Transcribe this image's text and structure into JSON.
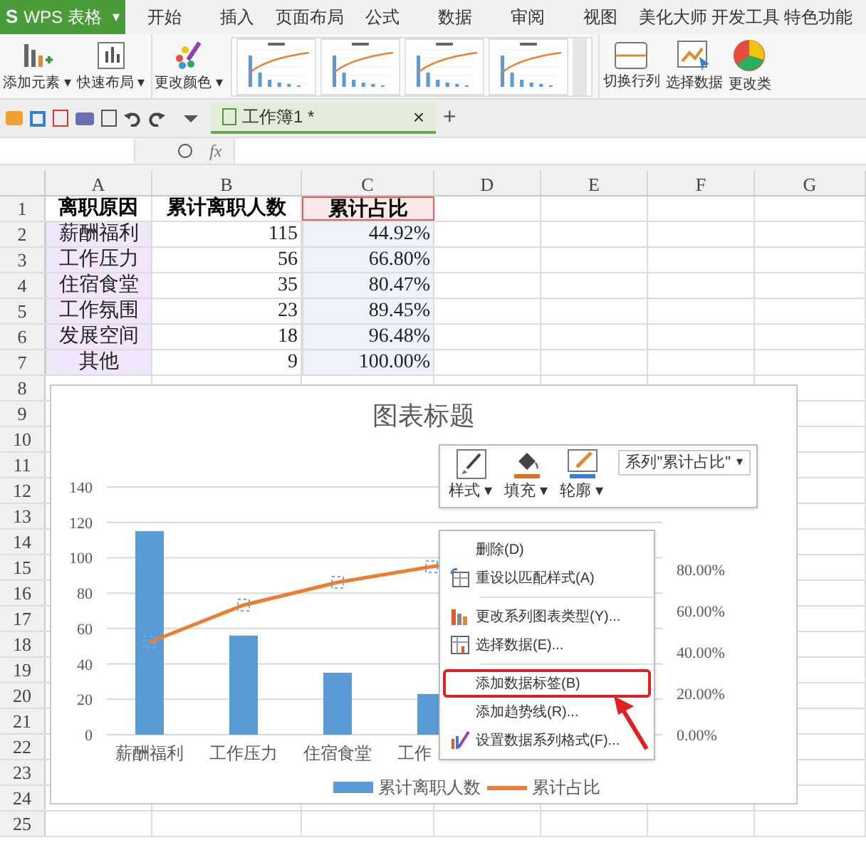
{
  "app": {
    "logo": "S",
    "name": "WPS 表格",
    "menu_caret": "▾"
  },
  "menu_tabs": [
    {
      "label": "开始"
    },
    {
      "label": "插入"
    },
    {
      "label": "页面布局"
    },
    {
      "label": "公式"
    },
    {
      "label": "数据"
    },
    {
      "label": "审阅"
    },
    {
      "label": "视图"
    },
    {
      "label": "美化大师"
    },
    {
      "label": "开发工具"
    },
    {
      "label": "特色功能"
    }
  ],
  "ribbon": {
    "left_buttons": [
      {
        "label": "添加元素",
        "caret": "▾",
        "kind": "add-element"
      },
      {
        "label": "快速布局",
        "caret": "▾",
        "kind": "layout"
      },
      {
        "label": "更改颜色",
        "caret": "▾",
        "kind": "colors"
      }
    ],
    "right_buttons": [
      {
        "label": "切换行列",
        "kind": "switch"
      },
      {
        "label": "选择数据",
        "kind": "select-data"
      },
      {
        "label": "更改类",
        "kind": "pie"
      }
    ]
  },
  "document_tab": {
    "title": "工作簿1 *",
    "close": "×",
    "new_tab": "+"
  },
  "formula_bar": {
    "fx": "fx"
  },
  "sheet": {
    "columns": [
      "A",
      "B",
      "C",
      "D",
      "E",
      "F",
      "G"
    ],
    "rows": [
      {
        "number": "1",
        "cells": [
          {
            "text": "离职原因",
            "kind": "heading"
          },
          {
            "text": "累计离职人数",
            "kind": "heading"
          },
          {
            "text": "累计占比",
            "kind": "series-name"
          }
        ]
      },
      {
        "number": "2",
        "cells": [
          {
            "text": "薪酬福利",
            "kind": "category"
          },
          {
            "text": "115",
            "kind": "plain"
          },
          {
            "text": "44.92%",
            "kind": "value"
          }
        ]
      },
      {
        "number": "3",
        "cells": [
          {
            "text": "工作压力",
            "kind": "category"
          },
          {
            "text": "56",
            "kind": "plain"
          },
          {
            "text": "66.80%",
            "kind": "value"
          }
        ]
      },
      {
        "number": "4",
        "cells": [
          {
            "text": "住宿食堂",
            "kind": "category"
          },
          {
            "text": "35",
            "kind": "plain"
          },
          {
            "text": "80.47%",
            "kind": "value"
          }
        ]
      },
      {
        "number": "5",
        "cells": [
          {
            "text": "工作氛围",
            "kind": "category"
          },
          {
            "text": "23",
            "kind": "plain"
          },
          {
            "text": "89.45%",
            "kind": "value"
          }
        ]
      },
      {
        "number": "6",
        "cells": [
          {
            "text": "发展空间",
            "kind": "category"
          },
          {
            "text": "18",
            "kind": "plain"
          },
          {
            "text": "96.48%",
            "kind": "value"
          }
        ]
      },
      {
        "number": "7",
        "cells": [
          {
            "text": "其他",
            "kind": "category"
          },
          {
            "text": "9",
            "kind": "plain"
          },
          {
            "text": "100.00%",
            "kind": "value"
          }
        ]
      },
      {
        "number": "8",
        "cells": []
      },
      {
        "number": "9",
        "cells": []
      },
      {
        "number": "10",
        "cells": []
      },
      {
        "number": "11",
        "cells": []
      },
      {
        "number": "12",
        "cells": []
      },
      {
        "number": "13",
        "cells": []
      },
      {
        "number": "14",
        "cells": []
      },
      {
        "number": "15",
        "cells": []
      },
      {
        "number": "16",
        "cells": []
      },
      {
        "number": "17",
        "cells": []
      },
      {
        "number": "18",
        "cells": []
      },
      {
        "number": "19",
        "cells": []
      },
      {
        "number": "20",
        "cells": []
      },
      {
        "number": "21",
        "cells": []
      },
      {
        "number": "22",
        "cells": []
      },
      {
        "number": "23",
        "cells": []
      },
      {
        "number": "24",
        "cells": []
      },
      {
        "number": "25",
        "cells": []
      }
    ]
  },
  "chart": {
    "chart_data": {
      "type": "bar",
      "title": "图表标题",
      "categories": [
        "薪酬福利",
        "工作压力",
        "住宿食堂",
        "工作"
      ],
      "series": [
        {
          "name": "累计离职人数",
          "color": "#5b9bd5",
          "values": [
            115,
            56,
            35,
            23
          ]
        }
      ],
      "ylim": [
        0,
        140
      ],
      "yticks": [
        0,
        20,
        40,
        60,
        80,
        100,
        120,
        140
      ],
      "grid": true
    },
    "secondary_axis_labels": [
      "80.00%",
      "60.00%",
      "40.00%",
      "20.00%",
      "0.00%"
    ],
    "line_legend": {
      "name": "累计占比",
      "color": "#ed7d31"
    }
  },
  "format_toolbar": {
    "buttons": [
      {
        "label": "样式",
        "caret": "▾",
        "kind": "style"
      },
      {
        "label": "填充",
        "caret": "▾",
        "kind": "fill"
      },
      {
        "label": "轮廓",
        "caret": "▾",
        "kind": "outline"
      }
    ],
    "series_select": "系列\"累计占比\"",
    "select_caret": "▾"
  },
  "context_menu": [
    {
      "label": "删除(D)",
      "kind": "plain",
      "highlighted": false
    },
    {
      "label": "重设以匹配样式(A)",
      "kind": "reset",
      "highlighted": false
    },
    {
      "kind": "separator"
    },
    {
      "label": "更改系列图表类型(Y)...",
      "kind": "chart-type",
      "highlighted": false
    },
    {
      "label": "选择数据(E)...",
      "kind": "select-data",
      "highlighted": false
    },
    {
      "kind": "separator"
    },
    {
      "label": "添加数据标签(B)",
      "kind": "plain",
      "highlighted": true
    },
    {
      "label": "添加趋势线(R)...",
      "kind": "plain",
      "highlighted": false
    },
    {
      "label": "设置数据系列格式(F)...",
      "kind": "format",
      "highlighted": false
    }
  ]
}
